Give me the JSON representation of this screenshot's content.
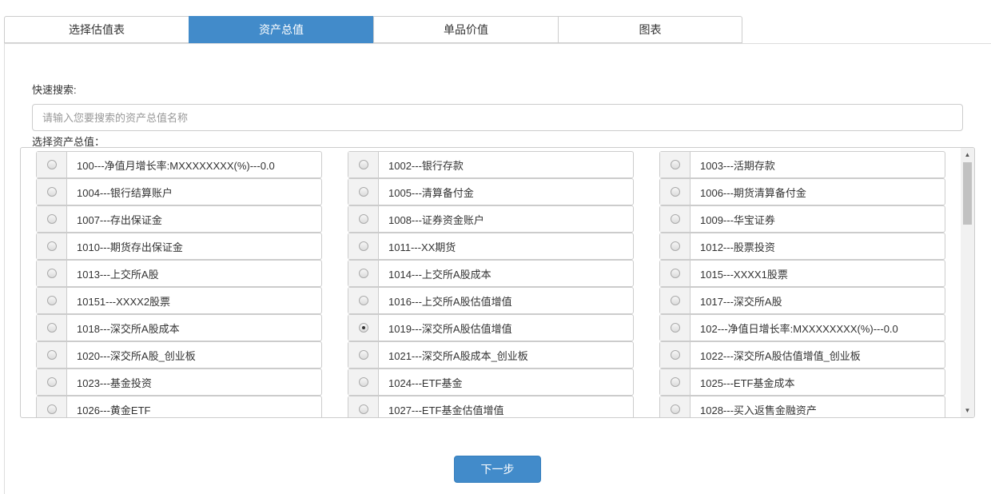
{
  "tabs": [
    {
      "label": "选择估值表",
      "active": false
    },
    {
      "label": "资产总值",
      "active": true
    },
    {
      "label": "单品价值",
      "active": false
    },
    {
      "label": "图表",
      "active": false
    }
  ],
  "search": {
    "label": "快速搜索:",
    "placeholder": "请输入您要搜索的资产总值名称",
    "value": ""
  },
  "select_label": "选择资产总值：",
  "options": [
    {
      "label": "100---净值月增长率:MXXXXXXXX(%)---0.0",
      "checked": false
    },
    {
      "label": "1002---银行存款",
      "checked": false
    },
    {
      "label": "1003---活期存款",
      "checked": false
    },
    {
      "label": "1004---银行结算账户",
      "checked": false
    },
    {
      "label": "1005---清算备付金",
      "checked": false
    },
    {
      "label": "1006---期货清算备付金",
      "checked": false
    },
    {
      "label": "1007---存出保证金",
      "checked": false
    },
    {
      "label": "1008---证券资金账户",
      "checked": false
    },
    {
      "label": "1009---华宝证券",
      "checked": false
    },
    {
      "label": "1010---期货存出保证金",
      "checked": false
    },
    {
      "label": "1011---XX期货",
      "checked": false
    },
    {
      "label": "1012---股票投资",
      "checked": false
    },
    {
      "label": "1013---上交所A股",
      "checked": false
    },
    {
      "label": "1014---上交所A股成本",
      "checked": false
    },
    {
      "label": "1015---XXXX1股票",
      "checked": false
    },
    {
      "label": "10151---XXXX2股票",
      "checked": false
    },
    {
      "label": "1016---上交所A股估值增值",
      "checked": false
    },
    {
      "label": "1017---深交所A股",
      "checked": false
    },
    {
      "label": "1018---深交所A股成本",
      "checked": false
    },
    {
      "label": "1019---深交所A股估值增值",
      "checked": true
    },
    {
      "label": "102---净值日增长率:MXXXXXXXX(%)---0.0",
      "checked": false
    },
    {
      "label": "1020---深交所A股_创业板",
      "checked": false
    },
    {
      "label": "1021---深交所A股成本_创业板",
      "checked": false
    },
    {
      "label": "1022---深交所A股估值增值_创业板",
      "checked": false
    },
    {
      "label": "1023---基金投资",
      "checked": false
    },
    {
      "label": "1024---ETF基金",
      "checked": false
    },
    {
      "label": "1025---ETF基金成本",
      "checked": false
    },
    {
      "label": "1026---黄金ETF",
      "checked": false
    },
    {
      "label": "1027---ETF基金估值增值",
      "checked": false
    },
    {
      "label": "1028---买入返售金融资产",
      "checked": false
    }
  ],
  "next_button": "下一步",
  "colors": {
    "accent": "#428bca"
  }
}
